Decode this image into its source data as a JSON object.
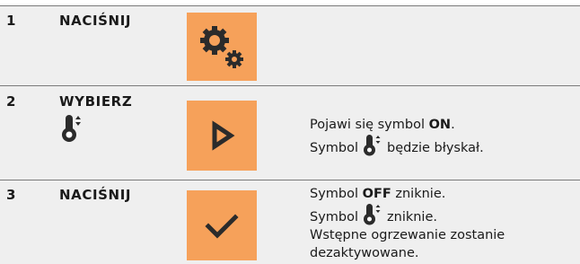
{
  "steps": [
    {
      "number": "1",
      "action": "NACIŚNIJ",
      "tile_icon": "gears-icon",
      "description": []
    },
    {
      "number": "2",
      "action": "WYBIERZ",
      "action_icon": "thermometer-icon",
      "tile_icon": "play-icon",
      "description": {
        "line1_before": "Pojawi się symbol ",
        "line1_bold": "ON",
        "line1_after": ".",
        "line2_before": "Symbol",
        "line2_icon": "thermometer-icon",
        "line2_after": "będzie błyskał."
      }
    },
    {
      "number": "3",
      "action": "NACIŚNIJ",
      "tile_icon": "check-icon",
      "description": {
        "line1_before": "Symbol ",
        "line1_bold": "OFF",
        "line1_after": " zniknie.",
        "line2_before": "Symbol",
        "line2_icon": "thermometer-icon",
        "line2_after": "zniknie.",
        "line3": "Wstępne ogrzewanie zostanie",
        "line4": "dezaktywowane."
      }
    }
  ],
  "colors": {
    "tile": "#f6a15a",
    "tile_icon": "#2b2b2b",
    "shade": "#efefef",
    "rule": "#7a7a7a"
  }
}
